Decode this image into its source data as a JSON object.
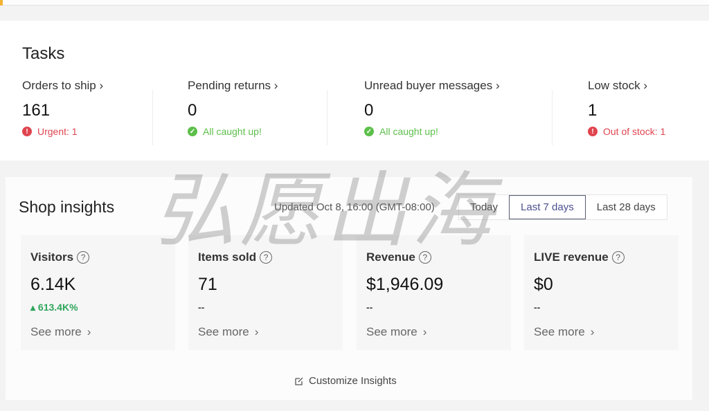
{
  "tasks": {
    "title": "Tasks",
    "items": [
      {
        "label": "Orders to ship",
        "value": "161",
        "status": "Urgent: 1",
        "status_type": "error"
      },
      {
        "label": "Pending returns",
        "value": "0",
        "status": "All caught up!",
        "status_type": "success"
      },
      {
        "label": "Unread buyer messages",
        "value": "0",
        "status": "All caught up!",
        "status_type": "success"
      },
      {
        "label": "Low stock",
        "value": "1",
        "status": "Out of stock: 1",
        "status_type": "error"
      }
    ]
  },
  "insights": {
    "title": "Shop insights",
    "updated": "Updated Oct 8, 16:00 (GMT-08:00)",
    "ranges": [
      "Today",
      "Last 7 days",
      "Last 28 days"
    ],
    "selected_range": "Last 7 days",
    "metrics": [
      {
        "label": "Visitors",
        "value": "6.14K",
        "change": "613.4K%",
        "change_dir": "up",
        "see_more": "See more"
      },
      {
        "label": "Items sold",
        "value": "71",
        "change": "--",
        "see_more": "See more"
      },
      {
        "label": "Revenue",
        "value": "$1,946.09",
        "change": "--",
        "see_more": "See more"
      },
      {
        "label": "LIVE revenue",
        "value": "$0",
        "change": "--",
        "see_more": "See more"
      }
    ],
    "customize": "Customize Insights"
  },
  "watermark": "弘愿出海",
  "colors": {
    "error": "#e0454f",
    "success": "#5cbf4a",
    "up": "#2ea55a",
    "accent": "#4b4f8f"
  }
}
